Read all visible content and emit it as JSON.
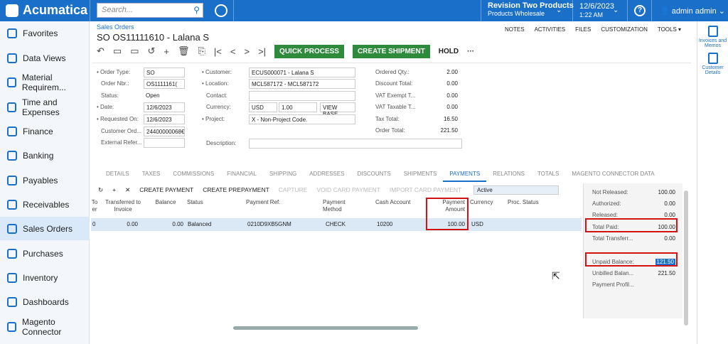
{
  "app": {
    "name": "Acumatica",
    "search_placeholder": "Search...",
    "branch": "Revision Two Products",
    "company": "Products Wholesale",
    "date": "12/6/2023",
    "time": "1:22 AM",
    "user": "admin admin"
  },
  "sidebar": {
    "items": [
      {
        "label": "Favorites"
      },
      {
        "label": "Data Views"
      },
      {
        "label": "Material Requirem..."
      },
      {
        "label": "Time and Expenses"
      },
      {
        "label": "Finance"
      },
      {
        "label": "Banking"
      },
      {
        "label": "Payables"
      },
      {
        "label": "Receivables"
      },
      {
        "label": "Sales Orders"
      },
      {
        "label": "Purchases"
      },
      {
        "label": "Inventory"
      },
      {
        "label": "Dashboards"
      },
      {
        "label": "Magento Connector"
      }
    ]
  },
  "right_panel": {
    "items": [
      {
        "label": "Invoices and Memos"
      },
      {
        "label": "Customer Details"
      }
    ]
  },
  "header": {
    "breadcrumb": "Sales Orders",
    "title": "SO OS11111610 - Lalana S",
    "actions": [
      "NOTES",
      "ACTIVITIES",
      "FILES",
      "CUSTOMIZATION",
      "TOOLS ▾"
    ]
  },
  "toolbar": {
    "quick_process": "QUICK PROCESS",
    "create_shipment": "CREATE SHIPMENT",
    "hold": "HOLD",
    "more": "···"
  },
  "form": {
    "order_type_label": "• Order Type:",
    "order_type": "SO",
    "order_nbr_label": "Order Nbr.:",
    "order_nbr": "OS1111161(",
    "status_label": "Status:",
    "status": "Open",
    "date_label": "• Date:",
    "date": "12/6/2023",
    "requested_on_label": "• Requested On:",
    "requested_on": "12/6/2023",
    "customer_ord_label": "Customer Ord...",
    "customer_ord": "24400000068€",
    "external_ref_label": "External Refer...",
    "external_ref": "",
    "customer_label": "• Customer:",
    "customer": "ECUS000071 - Lalana S",
    "location_label": "• Location:",
    "location": "MCL587172 - MCL587172",
    "contact_label": "Contact:",
    "contact": "",
    "currency_label": "Currency:",
    "currency": "USD",
    "currency_rate": "1.00",
    "view_base": "VIEW BASE",
    "project_label": "• Project:",
    "project": "X - Non-Project Code.",
    "description_label": "Description:",
    "description": "",
    "ordered_qty_label": "Ordered Qty.:",
    "ordered_qty": "2.00",
    "discount_total_label": "Discount Total:",
    "discount_total": "0.00",
    "vat_exempt_label": "VAT Exempt T...",
    "vat_exempt": "0.00",
    "vat_taxable_label": "VAT Taxable T...",
    "vat_taxable": "0.00",
    "tax_total_label": "Tax Total:",
    "tax_total": "16.50",
    "order_total_label": "Order Total:",
    "order_total": "221.50"
  },
  "tabs": [
    "DETAILS",
    "TAXES",
    "COMMISSIONS",
    "FINANCIAL",
    "SHIPPING",
    "ADDRESSES",
    "DISCOUNTS",
    "SHIPMENTS",
    "PAYMENTS",
    "RELATIONS",
    "TOTALS",
    "MAGENTO CONNECTOR DATA"
  ],
  "grid_toolbar": {
    "create_payment": "CREATE PAYMENT",
    "create_prepayment": "CREATE PREPAYMENT",
    "capture": "CAPTURE",
    "void_card_payment": "VOID CARD PAYMENT",
    "import_card_payment": "IMPORT CARD PAYMENT",
    "filter": "Active"
  },
  "grid": {
    "headers": [
      "To er",
      "Transferred to Invoice",
      "Balance",
      "Status",
      "Payment Ref.",
      "Payment Method",
      "Cash Account",
      "Payment Amount",
      "Currency",
      "Proc. Status"
    ],
    "row": [
      "0",
      "0.00",
      "0.00",
      "Balanced",
      "0210D9XB5GNM",
      "CHECK",
      "10200",
      "100.00",
      "USD",
      ""
    ]
  },
  "summary": [
    {
      "label": "Not Released:",
      "value": "100.00"
    },
    {
      "label": "Authorized:",
      "value": "0.00"
    },
    {
      "label": "Released:",
      "value": "0.00"
    },
    {
      "label": "Total Paid:",
      "value": "100.00"
    },
    {
      "label": "Total Transferr...",
      "value": "0.00"
    },
    {
      "label": "Unpaid Balance:",
      "value": "121.50"
    },
    {
      "label": "Unbilled Balan...",
      "value": "221.50"
    },
    {
      "label": "Payment Profil...",
      "value": ""
    }
  ],
  "colors": {
    "accent": "#1a6fc9",
    "green": "#2e8b3b",
    "highlight": "#d31212"
  }
}
